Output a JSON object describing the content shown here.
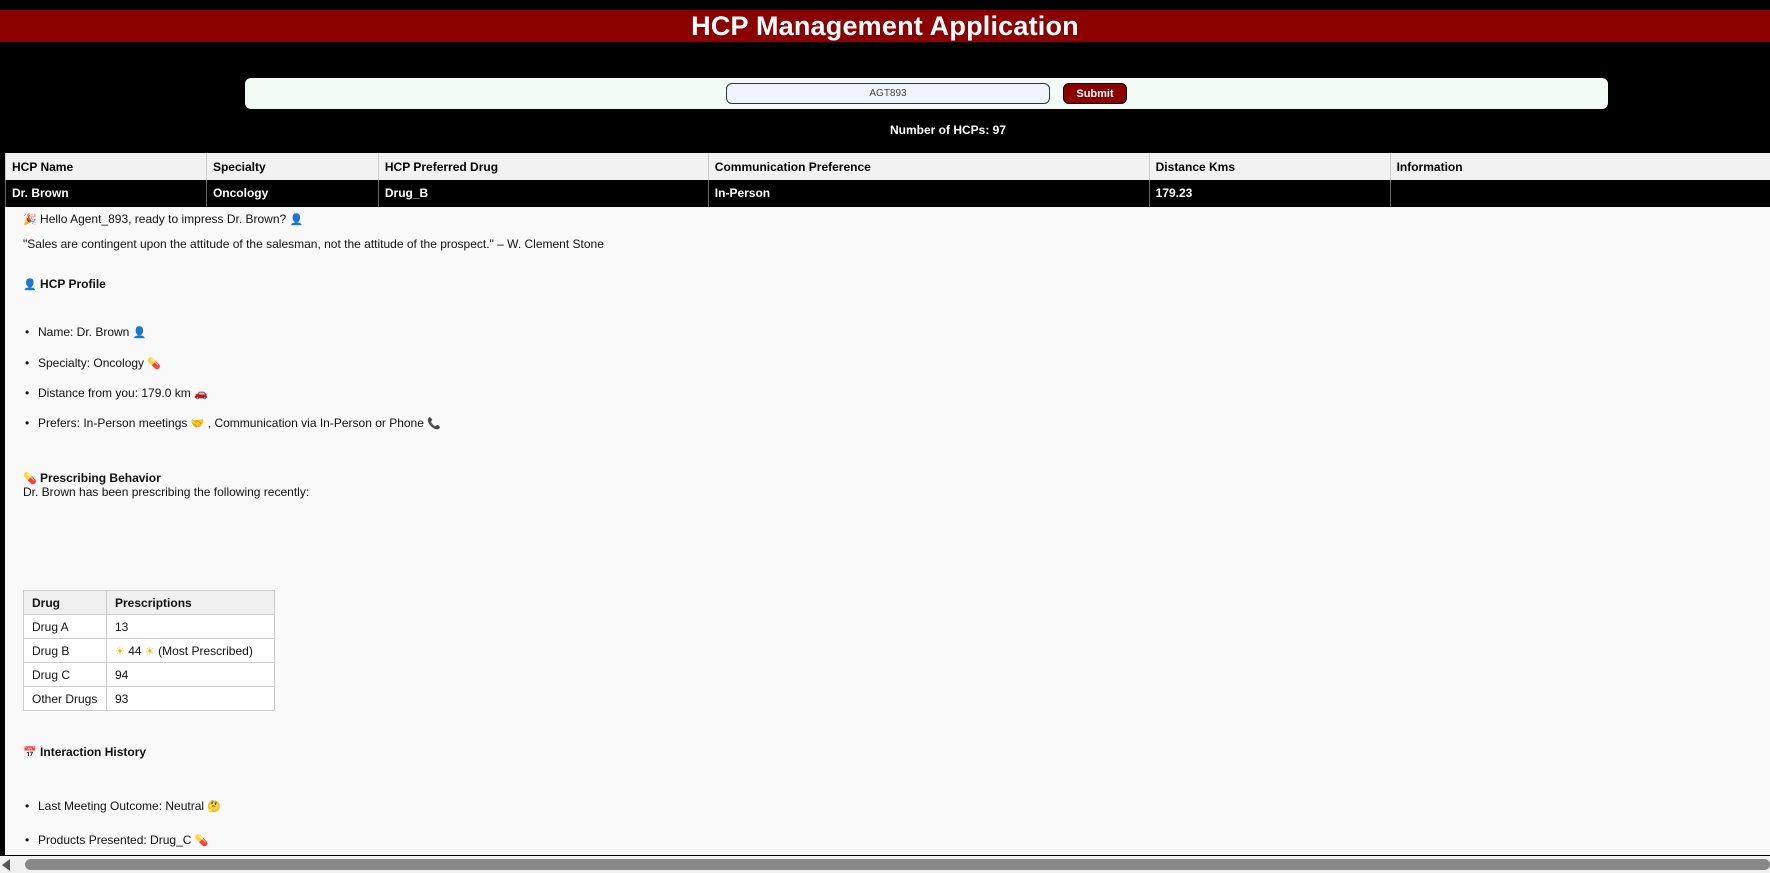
{
  "app": {
    "title": "HCP Management Application"
  },
  "search": {
    "agent_value": "AGT893",
    "submit_label": "Submit"
  },
  "summary": {
    "hcp_count_text": "Number of HCPs: 97"
  },
  "hcp_table": {
    "headers": [
      "HCP Name",
      "Specialty",
      "HCP Preferred Drug",
      "Communication Preference",
      "Distance Kms",
      "Information"
    ],
    "rows": [
      [
        "Dr. Brown",
        "Oncology",
        "Drug_B",
        "In-Person",
        "179.23",
        ""
      ]
    ]
  },
  "info": {
    "greeting": "Hello Agent_893, ready to impress Dr. Brown?",
    "quote": "\"Sales are contingent upon the attitude of the salesman, not the attitude of the prospect.\" – W. Clement Stone",
    "profile": {
      "title": "HCP Profile",
      "items": [
        "Name: Dr. Brown",
        "Specialty: Oncology",
        "Distance from you: 179.0 km",
        "Prefers: In-Person meetings",
        ", Communication via In-Person or Phone"
      ]
    },
    "prescribing": {
      "title": "Prescribing Behavior",
      "intro": "Dr. Brown has been prescribing the following recently:",
      "headers": [
        "Drug",
        "Prescriptions"
      ],
      "rows": [
        [
          "Drug A",
          "13"
        ],
        [
          "Drug B",
          "44"
        ],
        [
          "Drug C",
          "94"
        ],
        [
          "Other Drugs",
          "93"
        ]
      ],
      "most_prescribed_note": "(Most Prescribed)"
    },
    "interaction": {
      "title": "Interaction History",
      "items": [
        "Last Meeting Outcome: Neutral",
        "Products Presented: Drug_C"
      ]
    }
  },
  "icons": {
    "greeting": "party-icon",
    "person": "doctor-icon",
    "pill": "pill-icon",
    "car": "car-icon",
    "handshake": "handshake-icon",
    "phone": "phone-icon",
    "sun": "sun-icon",
    "calendar": "calendar-icon",
    "thinking": "thinking-face-icon"
  },
  "colors": {
    "brand": "#8b0000",
    "background": "#000000",
    "panel": "#f9f9f9"
  }
}
